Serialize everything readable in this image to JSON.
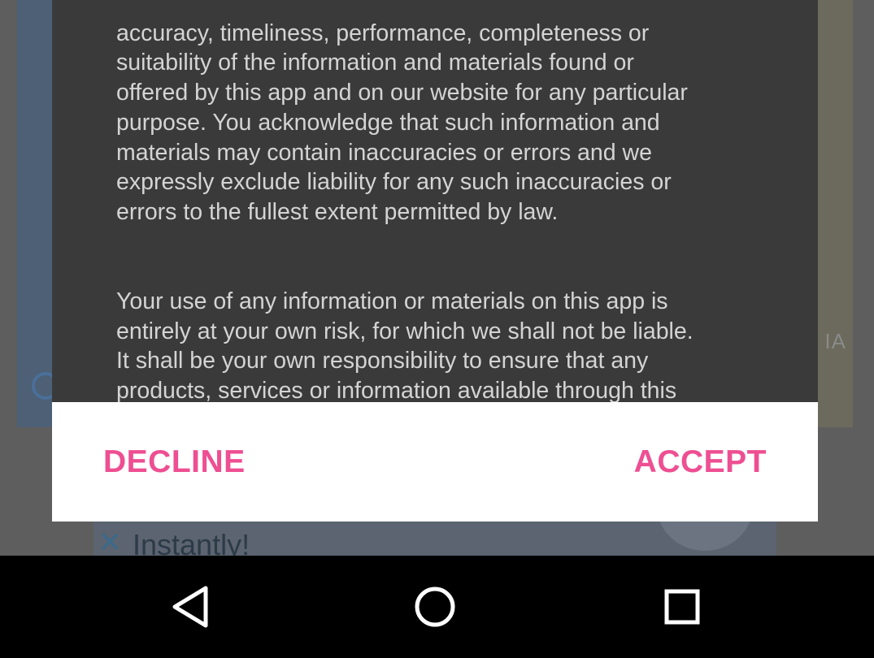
{
  "background": {
    "map_region_label": "IA",
    "ad_text": "Instantly!",
    "ad_close_glyph": "✕"
  },
  "dialog": {
    "paragraph_1": "accuracy, timeliness, performance, completeness or\nsuitability of the information and materials found or\noffered by this app and on our website for any particular\npurpose. You acknowledge that such information and\nmaterials may contain inaccuracies or errors and we\nexpressly exclude liability for any such inaccuracies or\nerrors to the fullest extent permitted by law.",
    "paragraph_2": "Your use of any information or materials on this app is\nentirely at your own risk, for which we shall not be liable.\nIt shall be your own responsibility to ensure that any\nproducts, services or information available through this\napps meet your specific requirements.",
    "decline_label": "DECLINE",
    "accept_label": "ACCEPT"
  },
  "colors": {
    "accent": "#ee4f92",
    "dialog_background": "#3a3a3a",
    "dialog_text": "#d4d4d4",
    "button_bar": "#ffffff",
    "nav_bar": "#000000"
  },
  "navbar": {
    "back_icon": "triangle-back-icon",
    "home_icon": "circle-home-icon",
    "recent_icon": "square-recents-icon"
  }
}
